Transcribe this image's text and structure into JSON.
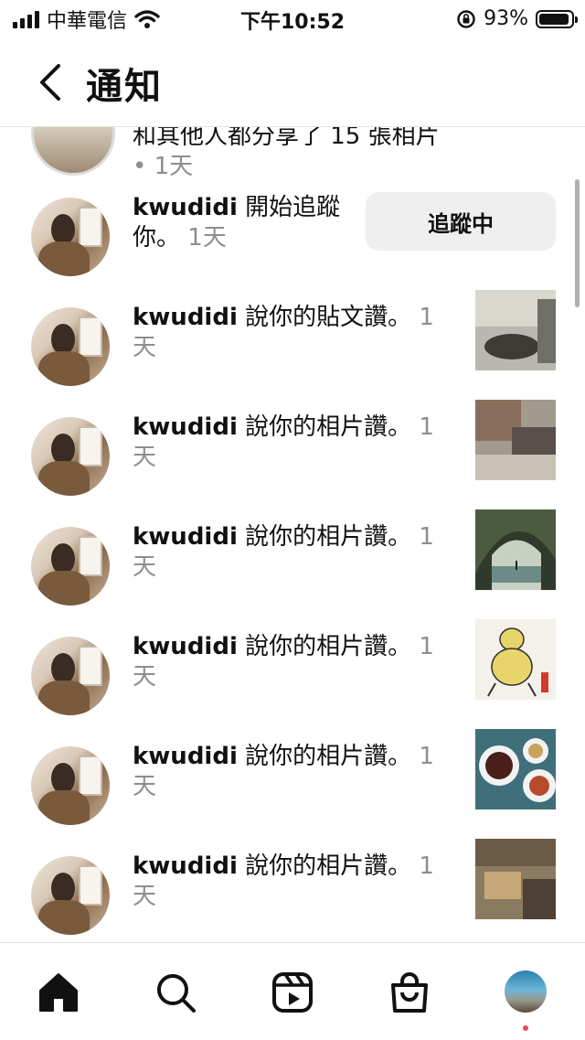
{
  "status_bar": {
    "carrier": "中華電信",
    "time": "下午10:52",
    "battery": "93%",
    "battery_level": 0.93
  },
  "header": {
    "title": "通知"
  },
  "partial_item": {
    "text": "和其他人都分享了 15 張相片",
    "sep": " • ",
    "time": "1天"
  },
  "follow_item": {
    "user": "kwudidi",
    "action": " 開始追蹤你。",
    "time": " 1天",
    "button_label": "追蹤中"
  },
  "items": [
    {
      "user": "kwudidi",
      "action": " 說你的貼文讚。",
      "time": " 1天",
      "thumb": "blurred-photo"
    },
    {
      "user": "kwudidi",
      "action": " 說你的相片讚。",
      "time": " 1天",
      "thumb": "blurred-photo"
    },
    {
      "user": "kwudidi",
      "action": " 說你的相片讚。",
      "time": " 1天",
      "thumb": "canyon-photo"
    },
    {
      "user": "kwudidi",
      "action": " 說你的相片讚。",
      "time": " 1天",
      "thumb": "drawing-photo"
    },
    {
      "user": "kwudidi",
      "action": " 說你的相片讚。",
      "time": " 1天",
      "thumb": "food-photo"
    },
    {
      "user": "kwudidi",
      "action": " 說你的相片讚。",
      "time": " 1天",
      "thumb": "blurred-photo"
    }
  ],
  "bottom_nav": [
    "home-icon",
    "search-icon",
    "reels-icon",
    "shop-icon",
    "profile-avatar"
  ],
  "colors": {
    "button_bg": "#efefef",
    "muted_text": "#8e8e8e",
    "notification_dot": "#ed4956"
  }
}
